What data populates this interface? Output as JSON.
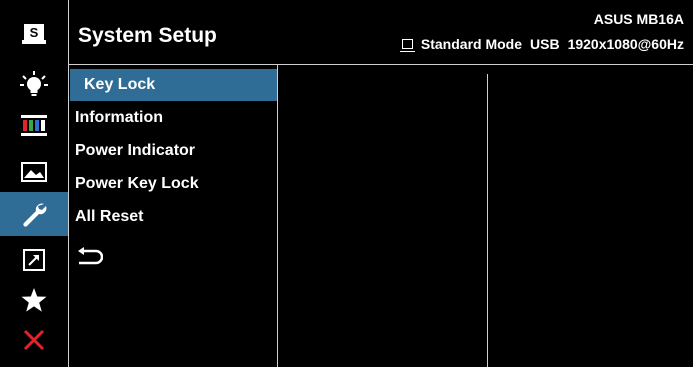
{
  "header": {
    "title": "System Setup",
    "model": "ASUS MB16A",
    "mode": "Standard Mode",
    "input": "USB",
    "resolution": "1920x1080@60Hz"
  },
  "sidebar": {
    "items": [
      {
        "name": "splendid",
        "label": "S",
        "icon": "splendid-icon"
      },
      {
        "name": "blue-light-filter",
        "icon": "bulb-icon"
      },
      {
        "name": "color",
        "icon": "color-bars-icon"
      },
      {
        "name": "image",
        "icon": "image-icon"
      },
      {
        "name": "system-setup",
        "icon": "wrench-icon",
        "active": true
      },
      {
        "name": "shortcut",
        "icon": "shortcut-arrow-icon"
      },
      {
        "name": "my-favorite",
        "icon": "star-icon"
      },
      {
        "name": "exit",
        "icon": "close-icon"
      }
    ]
  },
  "menu": {
    "items": [
      {
        "label": "Key Lock",
        "selected": true
      },
      {
        "label": "Information"
      },
      {
        "label": "Power Indicator"
      },
      {
        "label": "Power Key Lock"
      },
      {
        "label": "All Reset"
      },
      {
        "icon": "return-icon"
      }
    ]
  },
  "colors": {
    "background": "#000000",
    "accent": "#2f6d97",
    "exit": "#e4232a",
    "text": "#ffffff",
    "divider": "#cfcfcf"
  }
}
